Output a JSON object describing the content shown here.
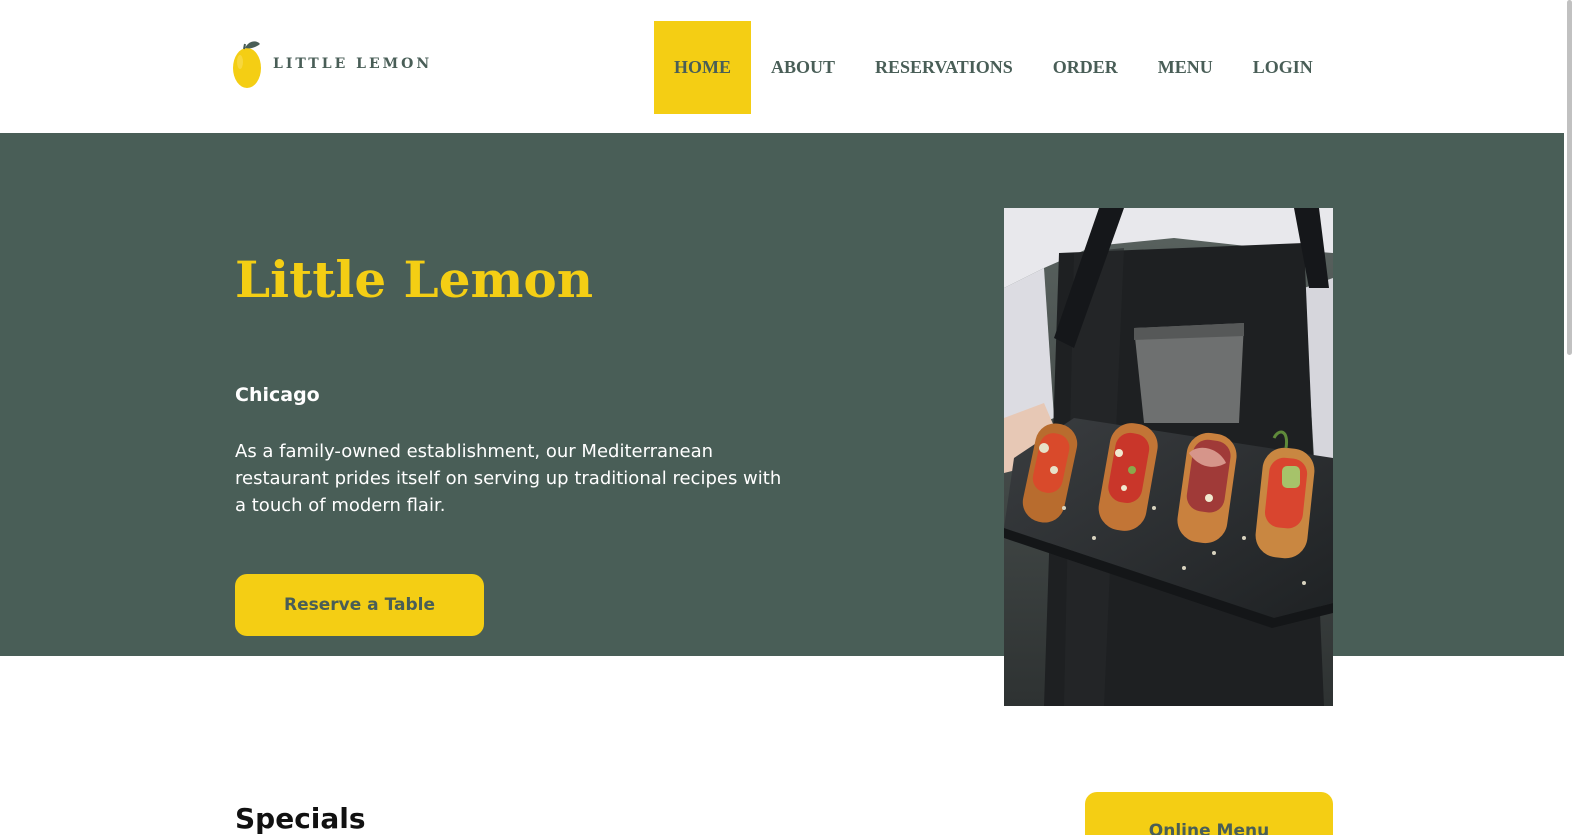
{
  "header": {
    "logo_text": "LITTLE LEMON",
    "nav": [
      {
        "label": "HOME",
        "active": true
      },
      {
        "label": "ABOUT",
        "active": false
      },
      {
        "label": "RESERVATIONS",
        "active": false
      },
      {
        "label": "ORDER",
        "active": false
      },
      {
        "label": "MENU",
        "active": false
      },
      {
        "label": "LOGIN",
        "active": false
      }
    ]
  },
  "hero": {
    "title": "Little Lemon",
    "city": "Chicago",
    "description": "As a family-owned establishment, our Mediterranean restaurant prides itself on serving up traditional recipes with a touch of modern flair.",
    "reserve_label": "Reserve a Table"
  },
  "specials": {
    "title": "Specials",
    "online_menu_label": "Online Menu"
  },
  "colors": {
    "primary_green": "#495E57",
    "primary_yellow": "#F4CE14",
    "white": "#FFFFFF"
  },
  "icons": {
    "logo": "lemon-icon"
  }
}
